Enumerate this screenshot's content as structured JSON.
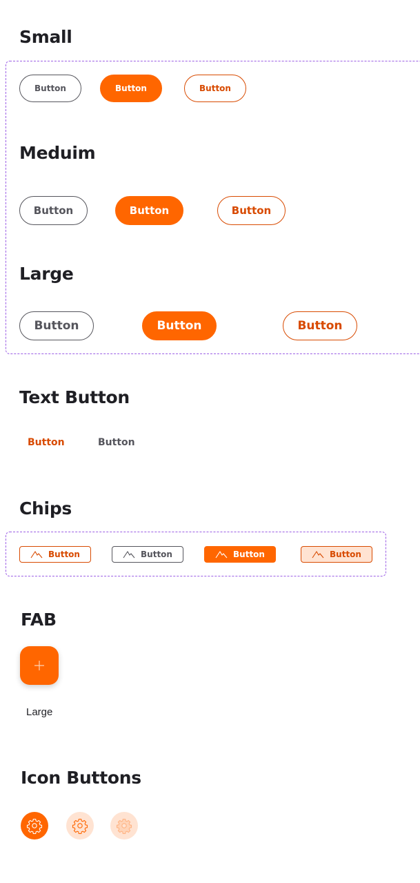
{
  "sections": {
    "small": "Small",
    "medium": "Meduim",
    "large": "Large",
    "text_button": "Text Button",
    "chips": "Chips",
    "fab": "FAB",
    "icon_buttons": "Icon Buttons"
  },
  "small_buttons": [
    "Button",
    "Button",
    "Button"
  ],
  "medium_buttons": [
    "Button",
    "Button",
    "Button"
  ],
  "large_buttons": [
    "Button",
    "Button",
    "Button"
  ],
  "text_buttons": [
    "Button",
    "Button"
  ],
  "chips": [
    {
      "label": "Button",
      "icon": "mountain-icon"
    },
    {
      "label": "Button",
      "icon": "mountain-icon"
    },
    {
      "label": "Button",
      "icon": "mountain-icon"
    },
    {
      "label": "Button",
      "icon": "mountain-icon"
    }
  ],
  "fab": {
    "icon": "plus-icon",
    "caption": "Large"
  },
  "icon_buttons": [
    {
      "icon": "gear-icon"
    },
    {
      "icon": "gear-icon"
    },
    {
      "icon": "gear-icon"
    }
  ],
  "colors": {
    "accent": "#ff6600",
    "accent_text": "#d84a00",
    "neutral": "#55555c",
    "tonal_bg": "#ffe3d2",
    "dash": "#9b5de5"
  }
}
